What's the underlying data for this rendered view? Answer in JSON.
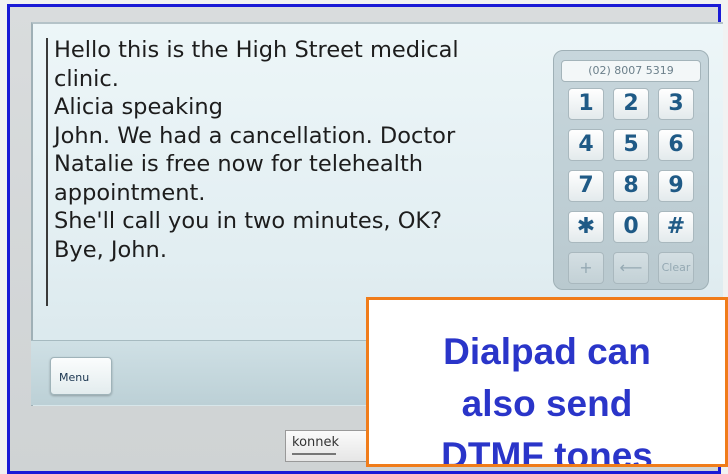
{
  "transcript": {
    "lines": [
      "Hello this is the High Street medical",
      "clinic.",
      "Alicia speaking",
      "John. We had a cancellation. Doctor",
      "Natalie is free now for telehealth",
      "appointment.",
      "She'll call you in two minutes, OK?",
      "Bye, John."
    ]
  },
  "dialpad": {
    "display_number": "(02) 8007 5319",
    "keys": [
      {
        "label": "1",
        "icon": "digit"
      },
      {
        "label": "2",
        "icon": "digit"
      },
      {
        "label": "3",
        "icon": "digit"
      },
      {
        "label": "4",
        "icon": "digit"
      },
      {
        "label": "5",
        "icon": "digit"
      },
      {
        "label": "6",
        "icon": "digit"
      },
      {
        "label": "7",
        "icon": "digit"
      },
      {
        "label": "8",
        "icon": "digit"
      },
      {
        "label": "9",
        "icon": "digit"
      },
      {
        "label": "✱",
        "icon": "star-icon"
      },
      {
        "label": "0",
        "icon": "digit"
      },
      {
        "label": "#",
        "icon": "hash-icon"
      }
    ],
    "function_keys": {
      "plus": "+",
      "backspace": "⟵",
      "clear": "Clear"
    }
  },
  "menu": {
    "label": "Menu"
  },
  "logo": {
    "text": "konnek"
  },
  "callout": {
    "lines": [
      "Dialpad can",
      "also send",
      "DTMF tones"
    ]
  },
  "colors": {
    "frame_border": "#1a1ad6",
    "callout_border": "#f07c1a",
    "callout_text": "#2a35c9",
    "key_text": "#1f5a86"
  }
}
